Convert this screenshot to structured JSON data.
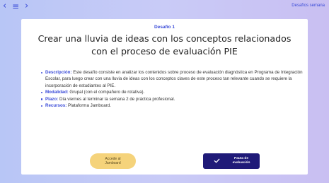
{
  "nav": {
    "back_glyph": "‹",
    "menu_glyph": "≡",
    "forward_glyph": "›",
    "section_link": "Desafíos semana"
  },
  "card": {
    "subtitle": "Desafío 1",
    "title": "Crear una lluvia de ideas con los conceptos relacionados con el proceso de evaluación PIE",
    "items": [
      {
        "label": "Descripción:",
        "text": " Este desafío consiste en analizar los contenidos sobre proceso de evaluación diagnóstica en Programa de Integración Escolar, para luego crear con una lluvia de ideas con los conceptos claves de este proceso tan relevante cuando se requiere la incorporación de estudiantes al PIE."
      },
      {
        "label": "Modalidad:",
        "text": " Grupal (con el compañero de rotativa)."
      },
      {
        "label": "Plazo:",
        "text": " Día viernes al terminar la semana 2 de práctica profesional."
      },
      {
        "label": "Recursos:",
        "text": " Plataforma Jamboard."
      }
    ],
    "btn_jamboard_line1": "Accede al",
    "btn_jamboard_line2": "Jamboard",
    "btn_rubric_line1": "Pauta de",
    "btn_rubric_line2": "evaluación"
  },
  "colors": {
    "accent": "#3a4bd8",
    "yellow_button": "#f5d37b",
    "navy_button": "#1f1a78"
  },
  "icons": {
    "back": "chevron-left-icon",
    "menu": "hamburger-menu-icon",
    "forward": "chevron-right-icon",
    "rubric": "check-icon"
  }
}
